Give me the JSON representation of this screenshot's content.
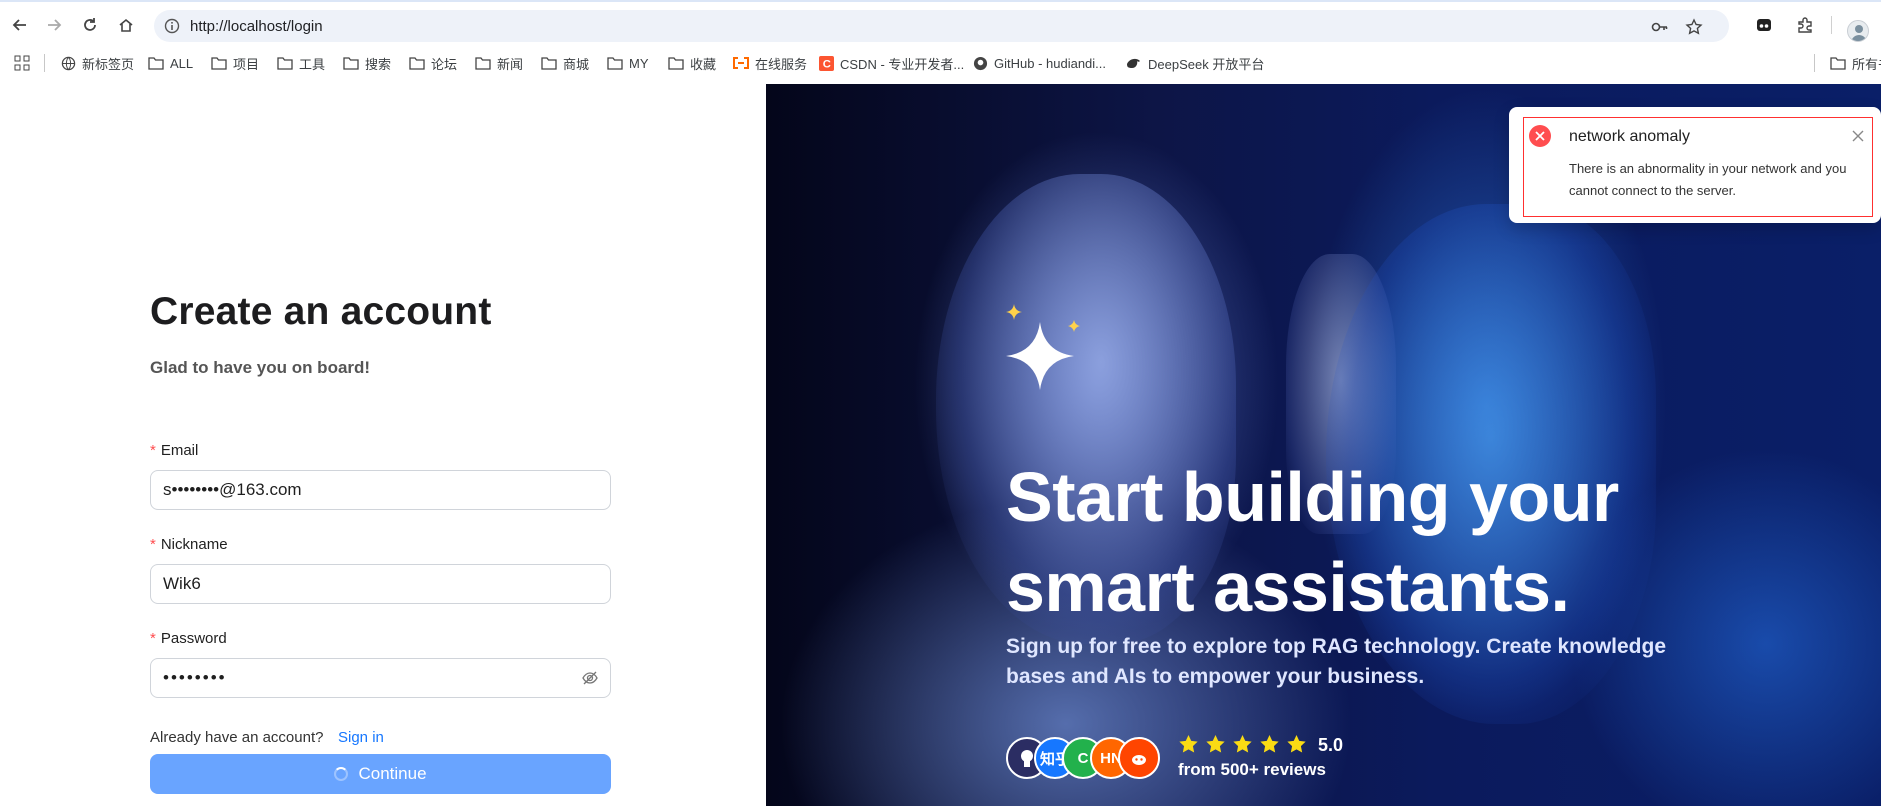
{
  "browser": {
    "url": "http://localhost/login",
    "bookmarks": [
      "新标签页",
      "ALL",
      "项目",
      "工具",
      "搜索",
      "论坛",
      "新闻",
      "商城",
      "MY",
      "收藏",
      "在线服务",
      "CSDN - 专业开发者...",
      "GitHub - hudiandi...",
      "DeepSeek 开放平台"
    ],
    "bookmark_overflow": "所有书"
  },
  "form": {
    "title": "Create an account",
    "subtitle": "Glad to have you on board!",
    "required_mark": "*",
    "email_label": "Email",
    "email_value": "s••••••••@163.com",
    "nickname_label": "Nickname",
    "nickname_value": "Wik6",
    "password_label": "Password",
    "password_value": "••••••••",
    "already_text": "Already have an account?",
    "signin_link": "Sign in",
    "continue_label": "Continue"
  },
  "hero": {
    "title": "Start building your smart assistants.",
    "subtitle": "Sign up for free to explore top RAG technology. Create knowledge bases and AIs to empower your business.",
    "logos": [
      "GitHub",
      "知乎",
      "C",
      "HN",
      "Reddit"
    ],
    "logo_texts": [
      "",
      "知乎",
      "C",
      "HN",
      ""
    ],
    "logo_colors": [
      "#2b2d63",
      "#1677ff",
      "#22b14c",
      "#ff6600",
      "#ff4500"
    ],
    "stars": 5,
    "rating": "5.0",
    "reviews": "from 500+ reviews"
  },
  "notification": {
    "title": "network anomaly",
    "message": "There is an abnormality in your network and you cannot connect to the server."
  },
  "colors": {
    "primary_button": "#69a4ff",
    "link": "#1677ff",
    "error": "#ff4d4f",
    "star": "#fadb14"
  }
}
